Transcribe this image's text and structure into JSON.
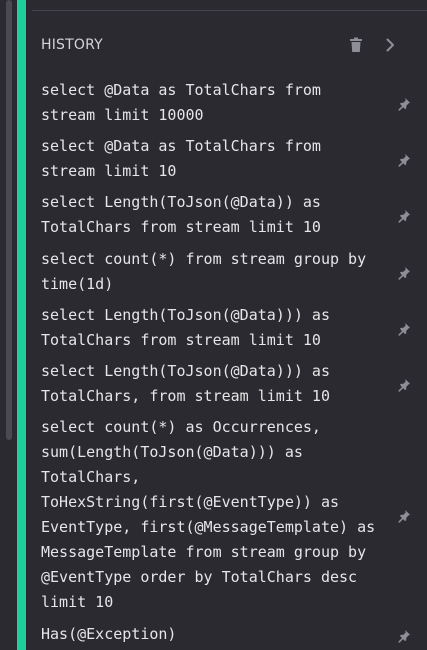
{
  "history": {
    "title": "HISTORY",
    "clear_icon": "trash-icon",
    "collapse_icon": "chevron-right-icon",
    "pin_icon": "pin-icon",
    "items": [
      {
        "query": "select @Data as TotalChars from\nstream limit 10000"
      },
      {
        "query": "select @Data as TotalChars from\nstream limit 10"
      },
      {
        "query": "select Length(ToJson(@Data)) as\nTotalChars from stream limit 10"
      },
      {
        "query": "select count(*) from stream group by\ntime(1d)"
      },
      {
        "query": "select Length(ToJson(@Data))) as\nTotalChars from stream limit 10"
      },
      {
        "query": "select Length(ToJson(@Data))) as\nTotalChars, from stream limit 10"
      },
      {
        "query": "select count(*) as Occurrences,\nsum(Length(ToJson(@Data))) as\nTotalChars,\nToHexString(first(@EventType)) as\nEventType, first(@MessageTemplate) as\nMessageTemplate from stream group by\n@EventType order by TotalChars desc\nlimit 10"
      },
      {
        "query": "Has(@Exception)"
      }
    ]
  },
  "colors": {
    "accent": "#1ecf9b",
    "background": "#2a2a30",
    "text": "#e6e6e8",
    "icon": "#8e8e96"
  }
}
